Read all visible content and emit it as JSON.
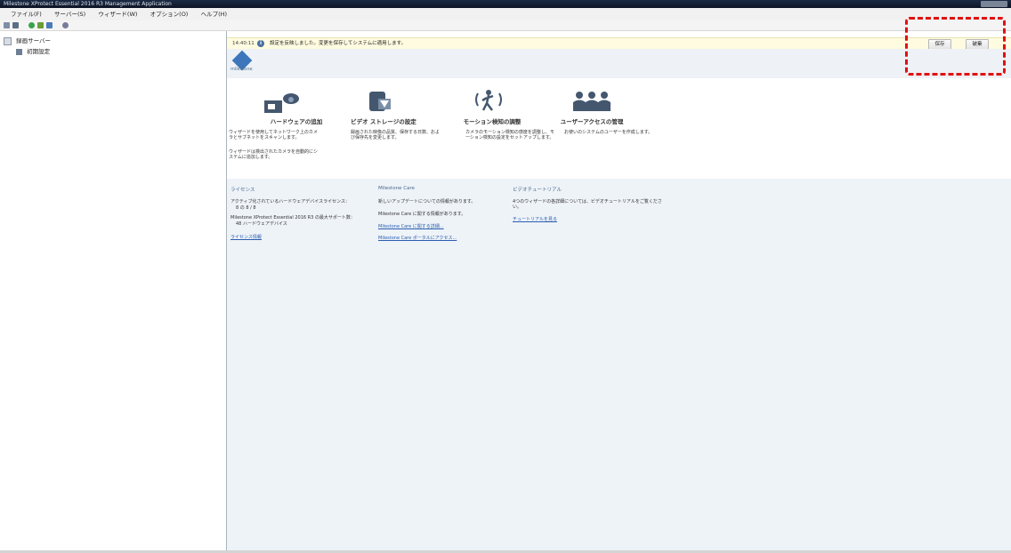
{
  "window": {
    "title": "Milestone XProtect Essential 2016 R3 Management Application"
  },
  "menu": [
    "ファイル(F)",
    "サーバー(S)",
    "ウィザード(W)",
    "オプション(O)",
    "ヘルプ(H)"
  ],
  "toolbar": {
    "icons": [
      "save-icon",
      "refresh-icon",
      "add-icon",
      "export-icon",
      "settings-icon",
      "help-icon"
    ]
  },
  "tree": {
    "root": "録画サーバー",
    "child": "初期設定"
  },
  "notice": {
    "time": "14:40:11",
    "message": "設定を反映しました。変更を保存してシステムに適用します。",
    "save_label": "保存",
    "cancel_label": "破棄"
  },
  "brand": {
    "name": "milestone"
  },
  "cards": [
    {
      "title": "ハードウェアの追加",
      "desc1": "ウィザードを使用してネットワーク上のカメラとサブネットをスキャンします。",
      "desc2": "ウィザードは検出されたカメラを自動的にシステムに追加します。"
    },
    {
      "title": "ビデオ ストレージの設定",
      "desc1": "録画された映像の品質、保存する日数、および保存先を変更します。"
    },
    {
      "title": "モーション検知の調整",
      "desc1": "カメラのモーション検知の感度を調整し、モーション検知の設定をセットアップします。"
    },
    {
      "title": "ユーザーアクセスの管理",
      "desc1": "お使いのシステムのユーザーを作成します。"
    }
  ],
  "license": {
    "heading": "ライセンス",
    "active_label": "アクティブ化されているハードウェアデバイスライセンス：",
    "active_value": "8 の 8 / 8",
    "max_label": "Milestone XProtect Essential 2016 R3 の最大サポート数：",
    "max_value": "48 ハードウェアデバイス",
    "link": "ライセンス情報"
  },
  "care": {
    "heading": "Milestone Care",
    "line1": "新しいアップデートについての情報があります。",
    "line2": "Milestone Care に関する情報があります。",
    "link1": "Milestone Care に関する詳細...",
    "link2": "Milestone Care ポータルにアクセス..."
  },
  "tutorial": {
    "heading": "ビデオチュートリアル",
    "text": "4つのウィザードの各詳細については、ビデオチュートリアルをご覧ください。",
    "link": "チュートリアルを見る"
  },
  "colors": {
    "accent": "#3d76ba",
    "notice_bg": "#fffbe0",
    "highlight": "#e01010"
  }
}
